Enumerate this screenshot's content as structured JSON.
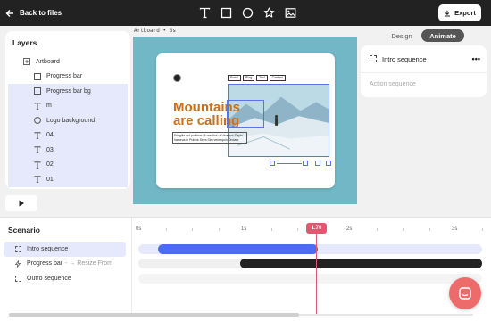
{
  "topbar": {
    "back_label": "Back to files",
    "tools": [
      "text-tool",
      "rectangle-tool",
      "ellipse-tool",
      "star-tool",
      "image-tool"
    ],
    "export_label": "Export"
  },
  "layers": {
    "title": "Layers",
    "items": [
      {
        "label": "Artboard",
        "icon": "artboard-icon",
        "selected": false
      },
      {
        "label": "Progress bar",
        "icon": "rectangle-icon",
        "selected": false
      },
      {
        "label": "Progress bar bg",
        "icon": "rectangle-icon",
        "selected": true
      },
      {
        "label": "m",
        "icon": "text-icon",
        "selected": true
      },
      {
        "label": "Logo background",
        "icon": "circle-icon",
        "selected": true
      },
      {
        "label": "04",
        "icon": "text-icon",
        "selected": true
      },
      {
        "label": "03",
        "icon": "text-icon",
        "selected": true
      },
      {
        "label": "02",
        "icon": "text-icon",
        "selected": true
      },
      {
        "label": "01",
        "icon": "text-icon",
        "selected": true
      }
    ]
  },
  "canvas": {
    "artboard_label": "Artboard • 5s",
    "nav_links": [
      "Portal",
      "Blog",
      "Tool",
      "Contact"
    ],
    "headline": "Mountains are calling",
    "blurb": "Fringilla est pulvinar @ rasellus ut Vivamus Dapis hameus in Pulvus Sees Sim vene quin Ondare."
  },
  "right_panel": {
    "tab_design": "Design",
    "tab_animate": "Animate",
    "sequence_name": "Intro sequence",
    "more_label": "•••",
    "action_placeholder": "Action sequence"
  },
  "timeline": {
    "title": "Scenario",
    "items": [
      {
        "label": "Intro sequence",
        "sub": "",
        "icon": "dotted-square-icon",
        "selected": true
      },
      {
        "label": "Progress bar",
        "sub": "- → Resize From",
        "icon": "lightning-icon",
        "selected": false
      },
      {
        "label": "Outro sequence",
        "sub": "",
        "icon": "dotted-square-icon",
        "selected": false
      }
    ],
    "ruler": [
      "0s",
      "1s",
      "2s",
      "3s"
    ],
    "playhead_time": "1.70",
    "tracks": [
      {
        "start": 0.19,
        "end": 1.7,
        "color": "#4a6cf0",
        "bg": "#e6e9fb"
      },
      {
        "start": 0.97,
        "end": 3.4,
        "color": "#222222",
        "bg": "#f0f0f0"
      },
      {
        "start": 0,
        "end": 0,
        "color": "#eeeeee",
        "bg": "#f4f4f4"
      }
    ]
  },
  "colors": {
    "accent": "#4a6cf0",
    "playhead": "#e0576f",
    "headline": "#c8701c",
    "artboard_bg": "#72b7c5",
    "chat": "#ee6b6b"
  }
}
